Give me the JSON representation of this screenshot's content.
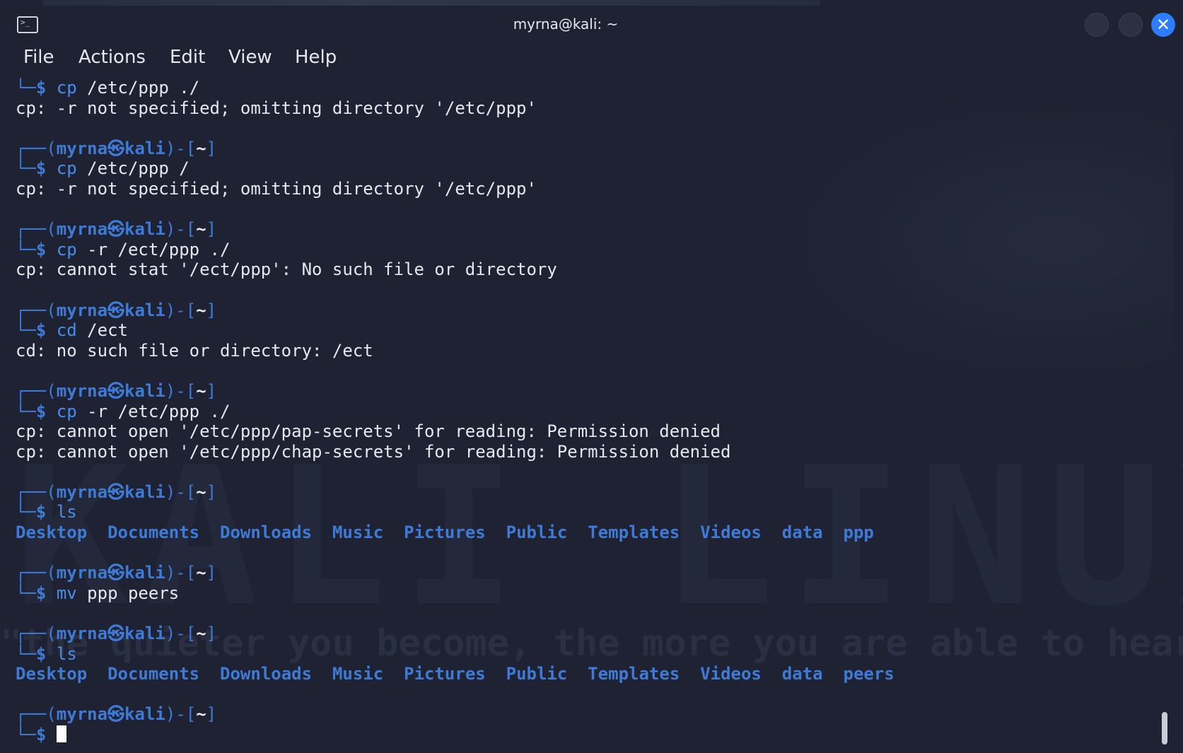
{
  "window": {
    "title": "myrna@kali: ~",
    "icon": "terminal-icon",
    "controls": [
      "minimize-icon",
      "maximize-icon",
      "close-icon"
    ]
  },
  "menu": {
    "file": "File",
    "actions": "Actions",
    "edit": "Edit",
    "view": "View",
    "help": "Help"
  },
  "prompt": {
    "frame_top_left": "┌──(",
    "user": "myrna",
    "at_symbol": "㉿",
    "host": "kali",
    "frame_mid": ")-[",
    "cwd": "~",
    "frame_end": "]",
    "frame_bottom": "└─",
    "dollar": "$"
  },
  "entries": [
    {
      "cmd": "cp",
      "args": " /etc/ppp ./",
      "output": [
        "cp: -r not specified; omitting directory '/etc/ppp'"
      ]
    },
    {
      "cmd": "cp",
      "args": " /etc/ppp /",
      "output": [
        "cp: -r not specified; omitting directory '/etc/ppp'"
      ]
    },
    {
      "cmd": "cp",
      "args": " -r /ect/ppp ./",
      "output": [
        "cp: cannot stat '/ect/ppp': No such file or directory"
      ]
    },
    {
      "cmd": "cd",
      "args": " /ect",
      "output": [
        "cd: no such file or directory: /ect"
      ]
    },
    {
      "cmd": "cp",
      "args": " -r /etc/ppp ./",
      "output": [
        "cp: cannot open '/etc/ppp/pap-secrets' for reading: Permission denied",
        "cp: cannot open '/etc/ppp/chap-secrets' for reading: Permission denied"
      ]
    },
    {
      "cmd": "ls",
      "dirs": [
        "Desktop",
        "Documents",
        "Downloads",
        "Music",
        "Pictures",
        "Public",
        "Templates",
        "Videos",
        "data",
        "ppp"
      ]
    },
    {
      "cmd": "mv",
      "args": " ppp peers"
    },
    {
      "cmd": "ls",
      "dirs": [
        "Desktop",
        "Documents",
        "Downloads",
        "Music",
        "Pictures",
        "Public",
        "Templates",
        "Videos",
        "data",
        "peers"
      ]
    }
  ],
  "background": {
    "watermark_title": "KALI LINUX",
    "watermark_tagline": "\"the quieter you become, the more you are able to hear\""
  }
}
